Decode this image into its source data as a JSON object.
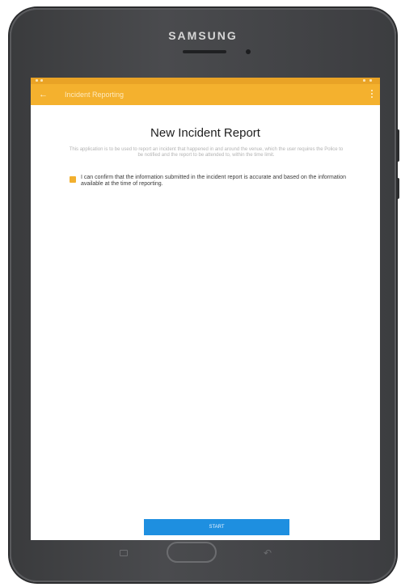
{
  "device": {
    "brand": "SAMSUNG"
  },
  "appbar": {
    "back_icon": "arrow-back-icon",
    "title": "Incident Reporting",
    "more_icon": "more-vert-icon"
  },
  "page": {
    "title": "New Incident Report",
    "description": "This application is to be used to report an incident that happened in and around the venue, which the user requires the Police to be notified and the report to be attended to, within the time limit.",
    "confirm_text": "I can confirm that the information submitted in the incident report is accurate and based on the information available at the time of reporting.",
    "confirm_checked": true
  },
  "footer": {
    "submit_label": "START"
  },
  "colors": {
    "appbar": "#f4b12e",
    "status_bar": "#e9a326",
    "checkbox": "#f2b02f",
    "button": "#1e8fe0"
  }
}
